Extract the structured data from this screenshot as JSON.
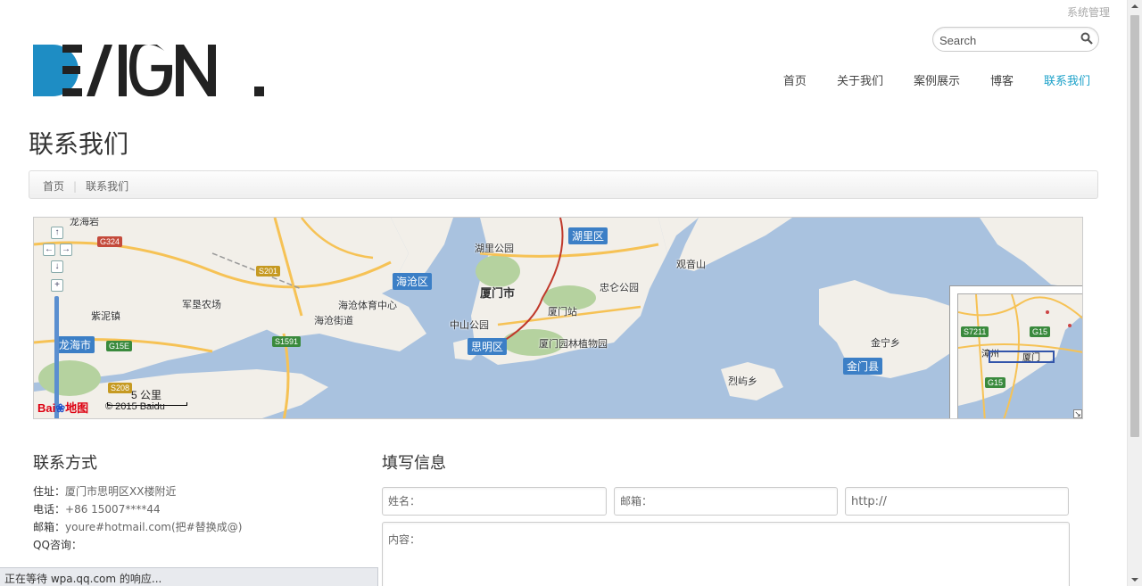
{
  "header": {
    "admin_link": "系统管理",
    "logo_text": "DESIGN.",
    "search": {
      "placeholder": "Search"
    },
    "nav": [
      {
        "label": "首页",
        "active": false
      },
      {
        "label": "关于我们",
        "active": false
      },
      {
        "label": "案例展示",
        "active": false
      },
      {
        "label": "博客",
        "active": false
      },
      {
        "label": "联系我们",
        "active": true
      }
    ]
  },
  "page_title": "联系我们",
  "breadcrumb": {
    "home": "首页",
    "current": "联系我们"
  },
  "map": {
    "places": {
      "xiamen": "厦门市",
      "huli_park": "湖里公园",
      "zhonglun_park": "忠仑公园",
      "xiamen_station": "厦门站",
      "zhongshan_park": "中山公园",
      "botanical": "厦门园林植物园",
      "guanyinshan": "观音山",
      "haicang_center": "海沧体育中心",
      "haicang_street": "海沧街道",
      "junken": "军垦农场",
      "zinijhen": "紫泥镇",
      "jinning": "金宁乡",
      "lieyu": "烈屿乡",
      "longhai_top": "龙海岩"
    },
    "districts": {
      "huli": "湖里区",
      "haicang": "海沧区",
      "siming": "思明区",
      "jinmen": "金门县",
      "longhai": "龙海市"
    },
    "roads": [
      "G324",
      "S201",
      "G15E",
      "S1591",
      "S208",
      "G15"
    ],
    "scale_label": "5 公里",
    "baidu_logo": "Bai",
    "baidu_logo_suffix": "地图",
    "copyright": "© 2015 Baidu",
    "overview": {
      "label_xiamen": "厦门",
      "label_zhangzhou": "漳州",
      "road1": "S7211",
      "road2": "G15",
      "road3": "G15"
    },
    "colors": {
      "water": "#a9c2df",
      "land": "#f2efe9",
      "green": "#b5d29f",
      "road": "#f6c255"
    }
  },
  "contact": {
    "title": "联系方式",
    "address_label": "住址：",
    "address": "厦门市思明区XX楼附近",
    "phone_label": "电话：",
    "phone": "+86 15007****44",
    "email_label": "邮箱：",
    "email": "youre#hotmail.com(把#替换成@)",
    "qq_label": "QQ咨询："
  },
  "form": {
    "title": "填写信息",
    "name_placeholder": "姓名：",
    "email_placeholder": "邮箱：",
    "url_placeholder": "http://",
    "content_placeholder": "内容："
  },
  "statusbar": "正在等待 wpa.qq.com 的响应..."
}
